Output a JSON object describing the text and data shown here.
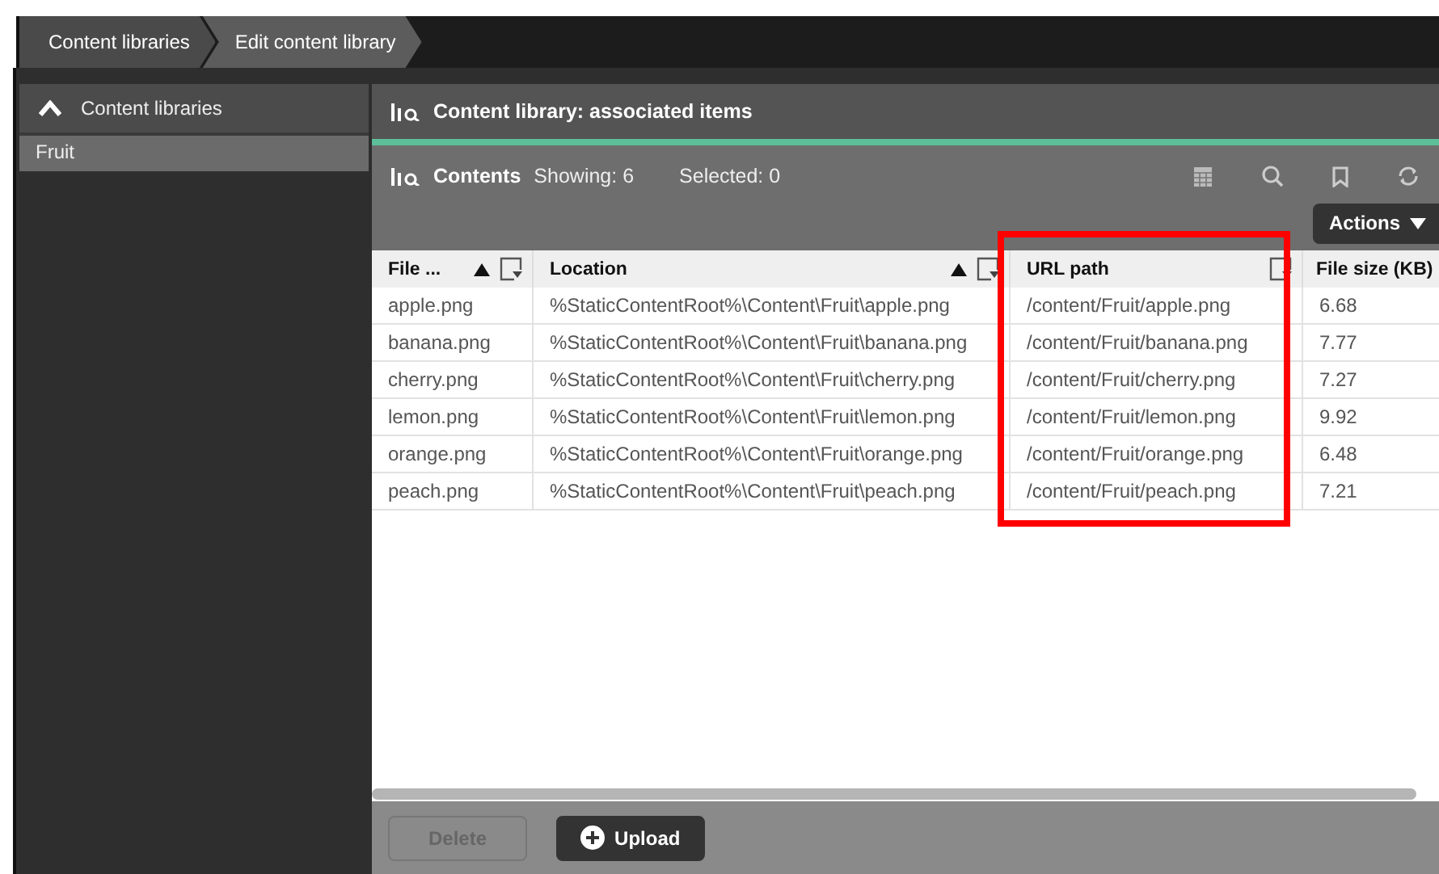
{
  "breadcrumbs": [
    {
      "label": "Content libraries",
      "selected": false
    },
    {
      "label": "Edit content library",
      "selected": true
    }
  ],
  "sidebar": {
    "header": "Content libraries",
    "expanded": true,
    "items": [
      {
        "label": "Fruit",
        "selected": true
      }
    ]
  },
  "panel": {
    "title": "Content library: associated items"
  },
  "toolbar": {
    "label": "Contents",
    "showing": "Showing: 6",
    "selected": "Selected: 0",
    "actions": "Actions"
  },
  "table": {
    "columns": [
      {
        "label": "File ...",
        "sorted": true,
        "filter": true,
        "highlighted": false
      },
      {
        "label": "Location",
        "sorted": true,
        "filter": true,
        "highlighted": false
      },
      {
        "label": "URL path",
        "sorted": false,
        "filter": true,
        "highlighted": true
      },
      {
        "label": "File size (KB)"
      }
    ],
    "rows": [
      [
        "apple.png",
        "%StaticContentRoot%\\Content\\Fruit\\apple.png",
        "/content/Fruit/apple.png",
        "6.68"
      ],
      [
        "banana.png",
        "%StaticContentRoot%\\Content\\Fruit\\banana.png",
        "/content/Fruit/banana.png",
        "7.77"
      ],
      [
        "cherry.png",
        "%StaticContentRoot%\\Content\\Fruit\\cherry.png",
        "/content/Fruit/cherry.png",
        "7.27"
      ],
      [
        "lemon.png",
        "%StaticContentRoot%\\Content\\Fruit\\lemon.png",
        "/content/Fruit/lemon.png",
        "9.92"
      ],
      [
        "orange.png",
        "%StaticContentRoot%\\Content\\Fruit\\orange.png",
        "/content/Fruit/orange.png",
        "6.48"
      ],
      [
        "peach.png",
        "%StaticContentRoot%\\Content\\Fruit\\peach.png",
        "/content/Fruit/peach.png",
        "7.21"
      ]
    ]
  },
  "buttons": [
    {
      "label": "Delete",
      "kind": "plain",
      "disabled": true
    },
    {
      "label": "Upload",
      "kind": "add",
      "disabled": false
    }
  ]
}
